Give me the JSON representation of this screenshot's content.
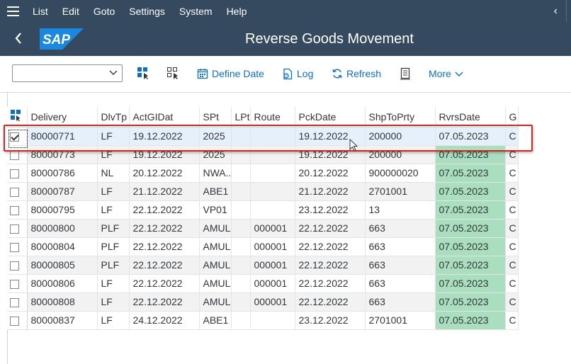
{
  "menubar": {
    "items": [
      "List",
      "Edit",
      "Goto",
      "Settings",
      "System",
      "Help"
    ],
    "back_glyph": "‹"
  },
  "shell": {
    "title": "Reverse Goods Movement",
    "logo_text": "SAP",
    "back_icon": "chevron-left-icon"
  },
  "toolbar": {
    "combo_value": "",
    "define_date": "Define Date",
    "log": "Log",
    "refresh": "Refresh",
    "more": "More"
  },
  "grid": {
    "columns": [
      "Delivery",
      "DlvTp",
      "ActGIDat",
      "SPt",
      "LPt",
      "Route",
      "PckDate",
      "ShpToPrty",
      "RvrsDate",
      "G"
    ],
    "rows": [
      {
        "checked": true,
        "cells": [
          "80000771",
          "LF",
          "19.12.2022",
          "2025",
          "",
          "",
          "19.12.2022",
          "200000",
          "07.05.2023",
          "C"
        ]
      },
      {
        "checked": false,
        "cells": [
          "80000773",
          "LF",
          "19.12.2022",
          "2025",
          "",
          "",
          "19.12.2022",
          "200000",
          "07.05.2023",
          "C"
        ]
      },
      {
        "checked": false,
        "cells": [
          "80000786",
          "NL",
          "20.12.2022",
          "NWA...",
          "",
          "",
          "20.12.2022",
          "900000020",
          "07.05.2023",
          "C"
        ]
      },
      {
        "checked": false,
        "cells": [
          "80000787",
          "LF",
          "21.12.2022",
          "ABE1",
          "",
          "",
          "21.12.2022",
          "2701001",
          "07.05.2023",
          "C"
        ]
      },
      {
        "checked": false,
        "cells": [
          "80000795",
          "LF",
          "22.12.2022",
          "VP01",
          "",
          "",
          "23.12.2022",
          "13",
          "07.05.2023",
          "C"
        ]
      },
      {
        "checked": false,
        "cells": [
          "80000800",
          "PLF",
          "22.12.2022",
          "AMUL",
          "",
          "000001",
          "22.12.2022",
          "663",
          "07.05.2023",
          "C"
        ]
      },
      {
        "checked": false,
        "cells": [
          "80000804",
          "PLF",
          "22.12.2022",
          "AMUL",
          "",
          "000001",
          "22.12.2022",
          "663",
          "07.05.2023",
          "C"
        ]
      },
      {
        "checked": false,
        "cells": [
          "80000805",
          "PLF",
          "22.12.2022",
          "AMUL",
          "",
          "000001",
          "22.12.2022",
          "663",
          "07.05.2023",
          "C"
        ]
      },
      {
        "checked": false,
        "cells": [
          "80000806",
          "LF",
          "22.12.2022",
          "AMUL",
          "",
          "000001",
          "22.12.2022",
          "663",
          "07.05.2023",
          "C"
        ]
      },
      {
        "checked": false,
        "cells": [
          "80000808",
          "LF",
          "22.12.2022",
          "AMUL",
          "",
          "000001",
          "22.12.2022",
          "663",
          "07.05.2023",
          "C"
        ]
      },
      {
        "checked": false,
        "cells": [
          "80000837",
          "LF",
          "24.12.2022",
          "ABE1",
          "",
          "",
          "23.12.2022",
          "2701001",
          "07.05.2023",
          "C"
        ]
      }
    ]
  },
  "colors": {
    "shell_bg": "#354a5f",
    "link_blue": "#0a6ed1",
    "rvrs_highlight": "#a9dfbf",
    "selection_box": "#d9261c",
    "sap_logo_blue": "#1a88e0"
  }
}
